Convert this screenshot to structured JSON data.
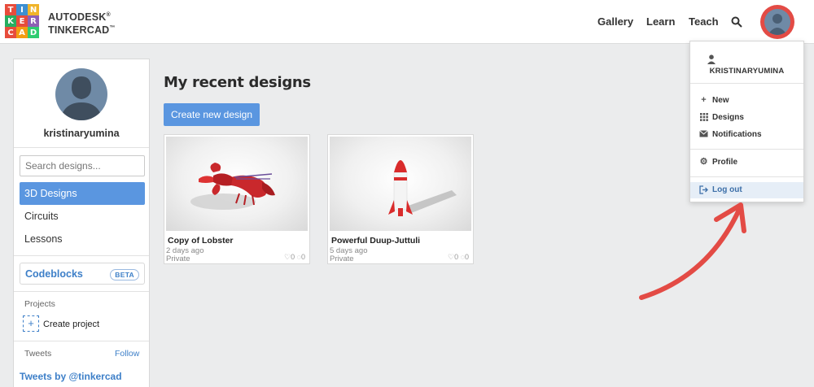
{
  "header": {
    "logo_letters": [
      "T",
      "I",
      "N",
      "K",
      "E",
      "R",
      "C",
      "A",
      "D"
    ],
    "brand_line1": "AUTODESK",
    "brand_line2": "TINKERCAD",
    "nav": [
      {
        "label": "Gallery"
      },
      {
        "label": "Learn"
      },
      {
        "label": "Teach"
      }
    ]
  },
  "sidebar": {
    "username": "kristinaryumina",
    "search_placeholder": "Search designs...",
    "items": [
      {
        "label": "3D Designs"
      },
      {
        "label": "Circuits"
      },
      {
        "label": "Lessons"
      }
    ],
    "codeblocks_label": "Codeblocks",
    "codeblocks_badge": "BETA",
    "projects_label": "Projects",
    "create_project_label": "Create project",
    "tweets_label": "Tweets",
    "follow_label": "Follow",
    "tweets_by": "Tweets by @tinkercad"
  },
  "main": {
    "title": "My recent designs",
    "create_button": "Create new design",
    "designs": [
      {
        "title": "Copy of Lobster",
        "date": "2 days ago",
        "visibility": "Private",
        "likes": "0",
        "comments": "0"
      },
      {
        "title": "Powerful Duup-Juttuli",
        "date": "5 days ago",
        "visibility": "Private",
        "likes": "0",
        "comments": "0"
      }
    ]
  },
  "dropdown": {
    "username": "KRISTINARYUMINA",
    "items": [
      {
        "label": "New",
        "icon": "plus-icon"
      },
      {
        "label": "Designs",
        "icon": "grid-icon"
      },
      {
        "label": "Notifications",
        "icon": "envelope-icon"
      },
      {
        "label": "Profile",
        "icon": "gear-icon"
      },
      {
        "label": "Log out",
        "icon": "logout-icon"
      }
    ]
  },
  "colors": {
    "accent": "#5a96e0",
    "link": "#3d7fc8",
    "annotation": "#e34b45",
    "logo": [
      "#e74c3c",
      "#3498db",
      "#f1c40f",
      "#27ae60",
      "#e74c3c",
      "#9b59b6",
      "#e74c3c",
      "#f39c12",
      "#2ecc71"
    ]
  }
}
